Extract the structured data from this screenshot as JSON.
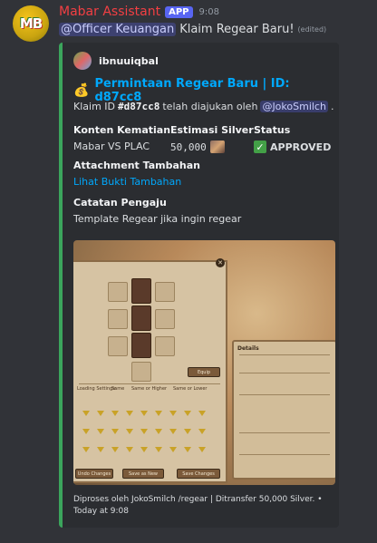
{
  "message": {
    "username": "Mabar Assistant",
    "badge": "APP",
    "time": "9:08",
    "mention": "@Officer Keuangan",
    "text": "Klaim Regear Baru!",
    "edited": "(edited)"
  },
  "embed": {
    "author": "ibnuuiqbal",
    "title": "Permintaan Regear Baru | ID: d87cc8",
    "desc_prefix": "Klaim ID",
    "desc_id": "#d87cc8",
    "desc_mid": "telah diajukan oleh",
    "desc_mention": "@JokoSmilch",
    "desc_end": ".",
    "fields": {
      "konten_name": "Konten Kematian",
      "konten_value": "Mabar VS PLAC",
      "silver_name": "Estimasi Silver",
      "silver_value": "50,000",
      "status_name": "Status",
      "status_value": "APPROVED",
      "attach_name": "Attachment Tambahan",
      "attach_value": "Lihat Bukti Tambahan",
      "catatan_name": "Catatan Pengaju",
      "catatan_value": "Template Regear jika ingin regear"
    },
    "footer": "Diproses oleh JokoSmilch /regear | Ditransfer 50,000 Silver. • Today at 9:08",
    "colors": {
      "accent": "#3ba55c",
      "link": "#00a8fc",
      "username": "#f23f43"
    }
  },
  "image": {
    "stats_title": "Details",
    "btn_undo": "Undo Changes",
    "btn_save": "Save as New",
    "btn_save2": "Save Changes",
    "btn_equip": "Equip",
    "label_settings": "Loading Settings:",
    "label_same": "Same",
    "label_higher": "Same or Higher",
    "label_lower": "Same or Lower"
  }
}
